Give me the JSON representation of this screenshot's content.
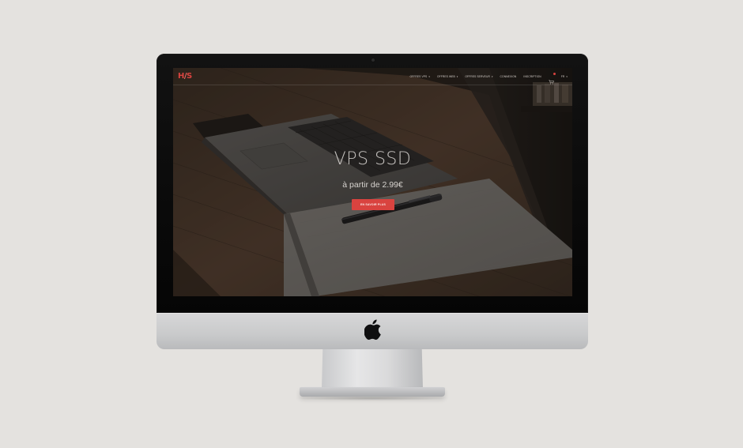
{
  "site": {
    "logo": {
      "main": "H",
      "accent": "S",
      "mid": "/"
    },
    "nav": {
      "items": [
        {
          "label": "OFFRES VPS",
          "has_caret": true
        },
        {
          "label": "OFFRES WEB",
          "has_caret": true
        },
        {
          "label": "OFFRES SERVEUR",
          "has_caret": true
        },
        {
          "label": "CONNEXION",
          "has_caret": false
        },
        {
          "label": "INSCRIPTION",
          "has_caret": false
        }
      ],
      "caret": "▾",
      "cart_icon": "shopping-cart-icon",
      "language": "FR",
      "language_caret": "▾"
    },
    "hero": {
      "title": "VPS SSD",
      "subtitle": "à partir de 2.99€",
      "button_label": "EN SAVOIR PLUS"
    }
  },
  "colors": {
    "background": "#e4e2df",
    "accent": "#d9433f",
    "bezel": "#0b0b0b",
    "chin": "#c9cacb"
  },
  "device": {
    "type": "iMac",
    "logo_icon": "apple-logo-icon"
  }
}
